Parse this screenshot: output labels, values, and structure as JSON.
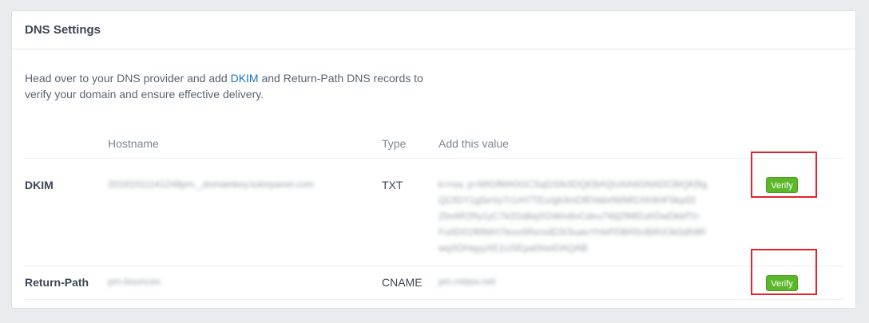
{
  "panel": {
    "title": "DNS Settings",
    "intro_before": "Head over to your DNS provider and add ",
    "intro_link": "DKIM",
    "intro_after": " and Return-Path DNS records to verify your domain and ensure effective delivery."
  },
  "table": {
    "columns": [
      "Hostname",
      "Type",
      "Add this value"
    ],
    "rows": [
      {
        "label": "DKIM",
        "hostname": "20181011141248pm._domainkey.tutorpanel.com",
        "type": "TXT",
        "value_lines": [
          "k=rsa; p=MIGfMA0GCSqGSIb3DQEBAQUAA4GNADCBiQKBg",
          "QCfGY1gSeVy7r1rH7TEu/gb3mDfEhbbrfWMf1XK6HF5kp02",
          "Zbv6R2fIy1yC7k2GdbqXGWm8vCdeu7WjZfMf2ufrDwDkkfTrr",
          "Fu0D01f6fWH7lexv0Re/xdD3/3uaivYHePDBR5cBIRX3k5d59R",
          "wqXDHqyyXE1USEpa0IiwIDAQAB"
        ],
        "verify_label": "Verify"
      },
      {
        "label": "Return-Path",
        "hostname": "pm-bounces",
        "type": "CNAME",
        "value": "pm.mtasv.net",
        "verify_label": "Verify"
      }
    ]
  },
  "colors": {
    "verify_button": "#5cb82b",
    "highlight": "#e0242a",
    "link": "#1a73b8"
  }
}
